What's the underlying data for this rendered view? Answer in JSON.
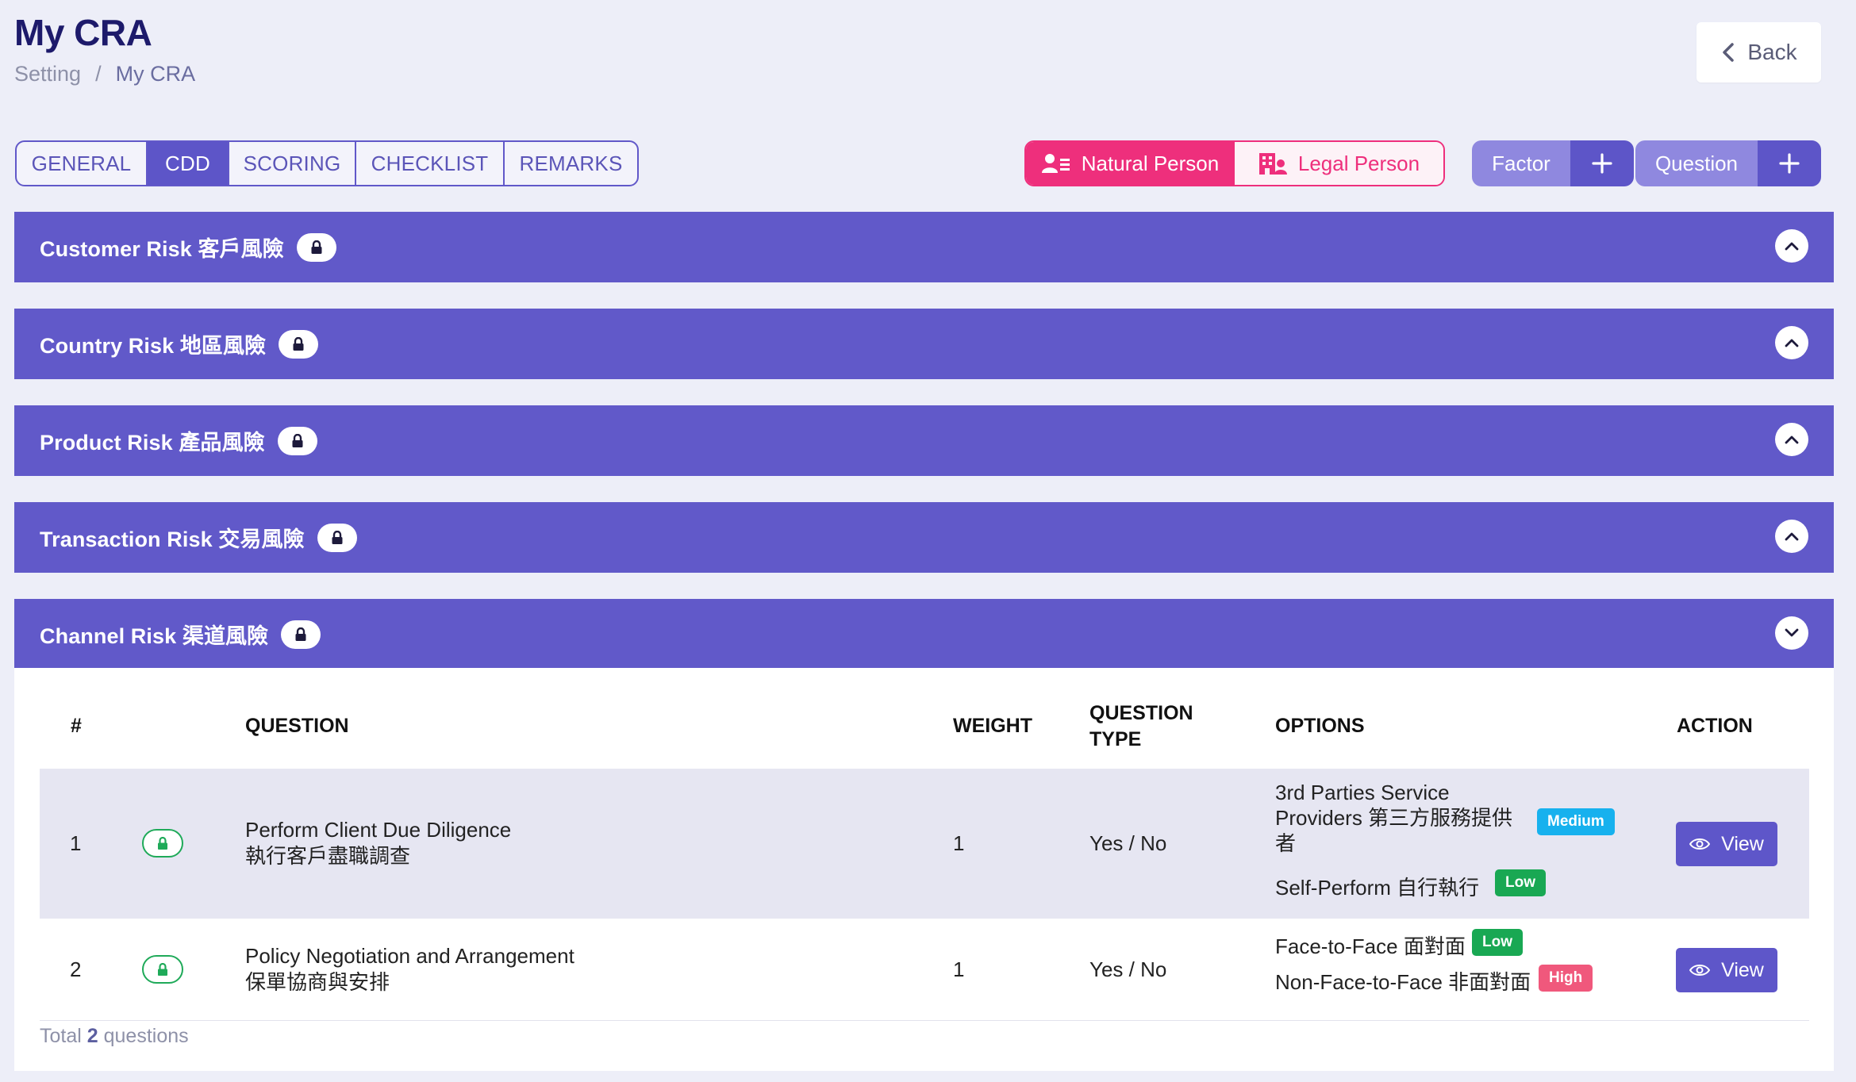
{
  "page": {
    "title": "My CRA",
    "breadcrumb": {
      "parent": "Setting",
      "separator": "/",
      "current": "My CRA"
    },
    "back_label": "Back"
  },
  "tabs": [
    {
      "label": "GENERAL",
      "active": false
    },
    {
      "label": "CDD",
      "active": true
    },
    {
      "label": "SCORING",
      "active": false
    },
    {
      "label": "CHECKLIST",
      "active": false
    },
    {
      "label": "REMARKS",
      "active": false
    }
  ],
  "person_toggle": {
    "natural": "Natural Person",
    "legal": "Legal Person",
    "selected": "natural"
  },
  "actions": {
    "factor": "Factor",
    "question": "Question"
  },
  "sections": [
    {
      "title": "Customer Risk 客戶風險",
      "expanded": false
    },
    {
      "title": "Country Risk 地區風險",
      "expanded": false
    },
    {
      "title": "Product Risk 產品風險",
      "expanded": false
    },
    {
      "title": "Transaction Risk 交易風險",
      "expanded": false
    },
    {
      "title": "Channel Risk 渠道風險",
      "expanded": true
    }
  ],
  "table": {
    "headers": {
      "num": "#",
      "question": "QUESTION",
      "weight": "WEIGHT",
      "qtype_1": "QUESTION",
      "qtype_2": "TYPE",
      "options": "OPTIONS",
      "action": "ACTION"
    },
    "rows": [
      {
        "num": "1",
        "question_en": "Perform Client Due Diligence",
        "question_zh": "執行客戶盡職調查",
        "weight": "1",
        "type": "Yes / No",
        "options": [
          {
            "line1": "3rd Parties Service",
            "line2": "Providers 第三方服務提供",
            "line3": "者",
            "level": "Medium"
          },
          {
            "text": "Self-Perform 自行執行",
            "level": "Low"
          }
        ],
        "action": "View"
      },
      {
        "num": "2",
        "question_en": "Policy Negotiation and Arrangement",
        "question_zh": "保單協商與安排",
        "weight": "1",
        "type": "Yes / No",
        "options": [
          {
            "text": "Face-to-Face 面對面",
            "level": "Low"
          },
          {
            "text": "Non-Face-to-Face 非面對面",
            "level": "High"
          }
        ],
        "action": "View"
      }
    ],
    "footer": {
      "prefix": "Total",
      "count": "2",
      "suffix": "questions"
    }
  },
  "colors": {
    "primary": "#6159c9",
    "pink": "#ee2f7c",
    "low": "#19a853",
    "medium": "#17b1ee",
    "high": "#f0587c"
  }
}
